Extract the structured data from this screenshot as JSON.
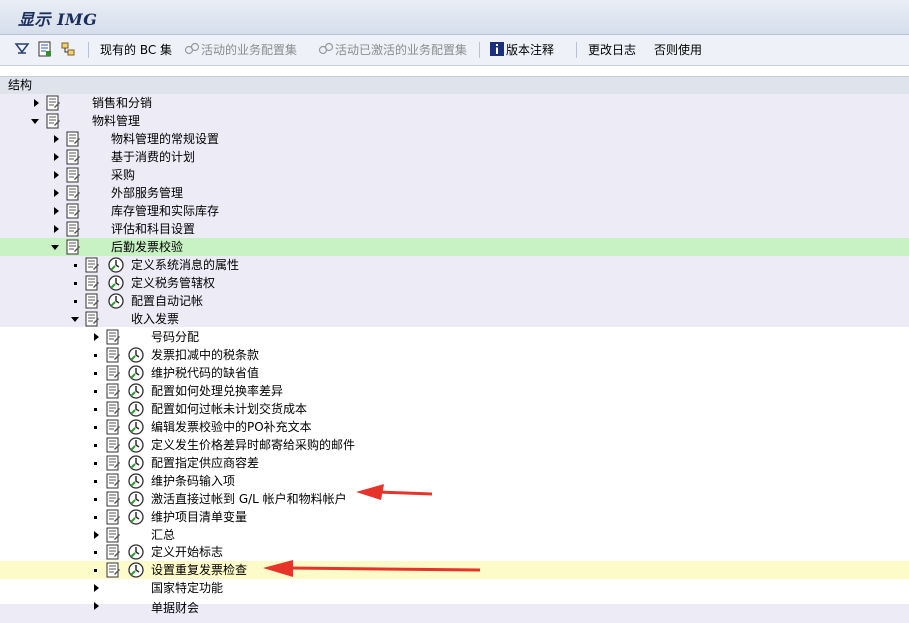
{
  "window": {
    "title": "显示 IMG"
  },
  "toolbar": {
    "bc_sets": "现有的 BC 集",
    "active_bc": "活动的业务配置集",
    "activated_bc": "活动已激活的业务配置集",
    "release_notes": "版本注释",
    "change_log": "更改日志",
    "where_used": "否则使用"
  },
  "tree": {
    "header": "结构",
    "sales": "销售和分销",
    "mm": "物料管理",
    "mm_children": [
      "物料管理的常规设置",
      "基于消费的计划",
      "采购",
      "外部服务管理",
      "库存管理和实际库存",
      "评估和科目设置"
    ],
    "liv": "后勤发票校验",
    "liv_children": [
      "定义系统消息的属性",
      "定义税务管辖权",
      "配置自动记帐"
    ],
    "incoming": "收入发票",
    "incoming_children": [
      "号码分配",
      "发票扣减中的税条款",
      "维护税代码的缺省值",
      "配置如何处理兑换率差异",
      "配置如何过帐未计划交货成本",
      "编辑发票校验中的PO补充文本",
      "定义发生价格差异时邮寄给采购的邮件",
      "配置指定供应商容差",
      "维护条码输入项",
      "激活直接过帐到 G/L 帐户和物料帐户",
      "维护项目清单变量",
      "汇总",
      "定义开始标志",
      "设置重复发票检查",
      "国家特定功能",
      "单据财会"
    ]
  },
  "colors": {
    "selected_green": "#c8f2c4",
    "selected_yellow": "#fdfbc8",
    "arrow_red": "#e8332b"
  }
}
